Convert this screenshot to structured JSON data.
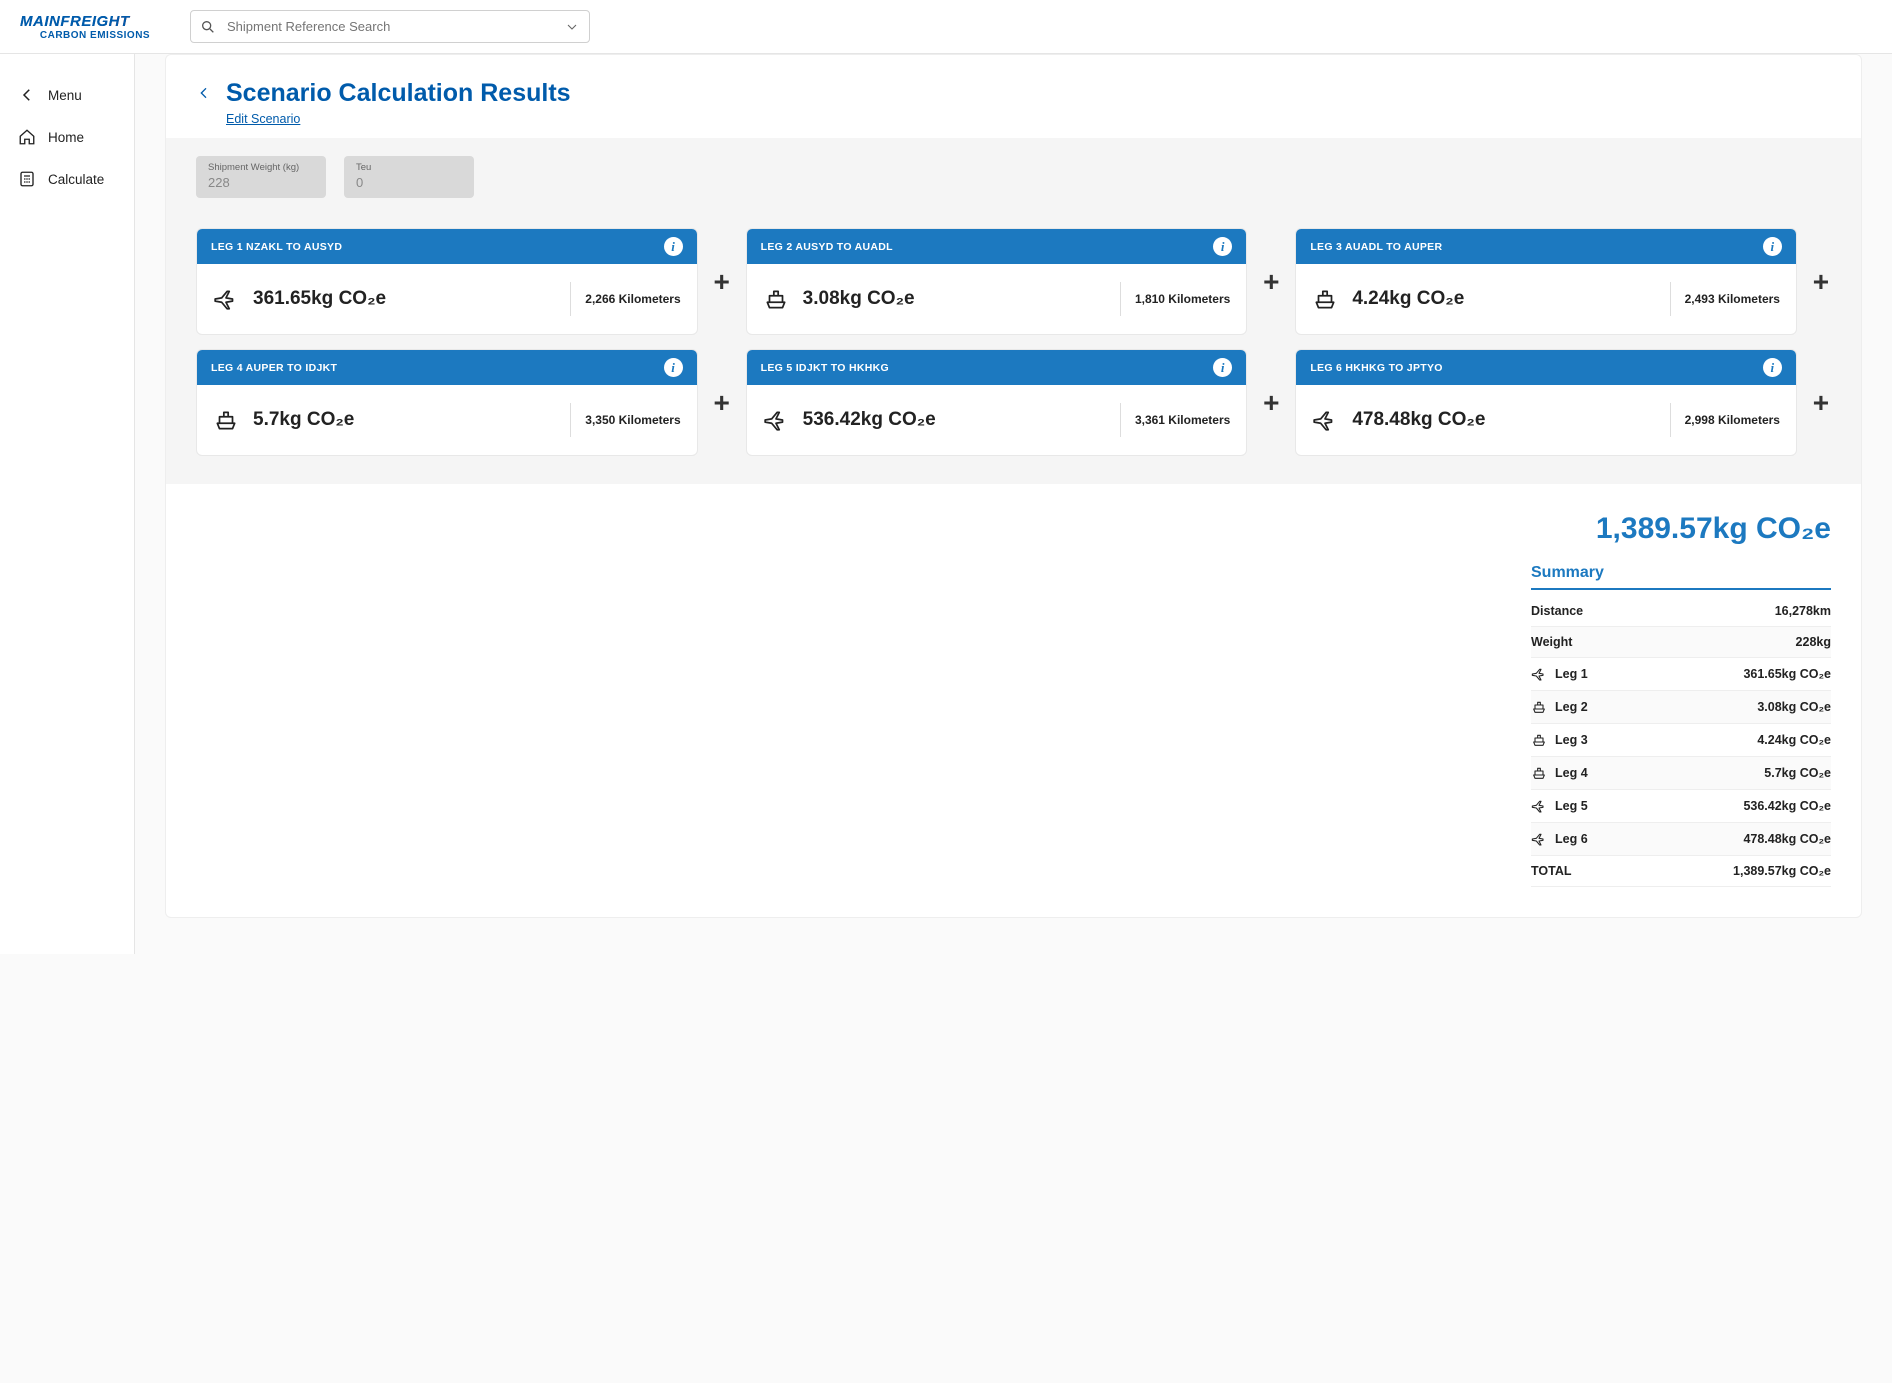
{
  "header": {
    "logo_main": "MAINFREIGHT",
    "logo_sub": "CARBON EMISSIONS",
    "search_placeholder": "Shipment Reference Search"
  },
  "sidebar": {
    "items": [
      {
        "label": "Menu",
        "icon": "chevron-left"
      },
      {
        "label": "Home",
        "icon": "home"
      },
      {
        "label": "Calculate",
        "icon": "calculate"
      }
    ]
  },
  "page": {
    "title": "Scenario Calculation Results",
    "edit_link": "Edit Scenario"
  },
  "inputs": {
    "weight_label": "Shipment Weight (kg)",
    "weight_value": "228",
    "teu_label": "Teu",
    "teu_value": "0"
  },
  "legs": [
    {
      "title": "LEG 1  NZAKL  TO  AUSYD",
      "mode": "plane",
      "co2": "361.65kg CO₂e",
      "distance": "2,266 Kilometers"
    },
    {
      "title": "LEG 2  AUSYD  TO  AUADL",
      "mode": "ship",
      "co2": "3.08kg CO₂e",
      "distance": "1,810 Kilometers"
    },
    {
      "title": "LEG 3  AUADL  TO  AUPER",
      "mode": "ship",
      "co2": "4.24kg CO₂e",
      "distance": "2,493 Kilometers"
    },
    {
      "title": "LEG 4  AUPER  TO  IDJKT",
      "mode": "ship",
      "co2": "5.7kg CO₂e",
      "distance": "3,350 Kilometers"
    },
    {
      "title": "LEG 5  IDJKT  TO  HKHKG",
      "mode": "plane",
      "co2": "536.42kg CO₂e",
      "distance": "3,361 Kilometers"
    },
    {
      "title": "LEG 6  HKHKG  TO  JPTYO",
      "mode": "plane",
      "co2": "478.48kg CO₂e",
      "distance": "2,998 Kilometers"
    }
  ],
  "total": "1,389.57kg CO₂e",
  "summary": {
    "title": "Summary",
    "rows": [
      {
        "label": "Distance",
        "value": "16,278km",
        "icon": ""
      },
      {
        "label": "Weight",
        "value": "228kg",
        "icon": ""
      },
      {
        "label": "Leg 1",
        "value": "361.65kg CO₂e",
        "icon": "plane"
      },
      {
        "label": "Leg 2",
        "value": "3.08kg CO₂e",
        "icon": "ship"
      },
      {
        "label": "Leg 3",
        "value": "4.24kg CO₂e",
        "icon": "ship"
      },
      {
        "label": "Leg 4",
        "value": "5.7kg CO₂e",
        "icon": "ship"
      },
      {
        "label": "Leg 5",
        "value": "536.42kg CO₂e",
        "icon": "plane"
      },
      {
        "label": "Leg 6",
        "value": "478.48kg CO₂e",
        "icon": "plane"
      },
      {
        "label": "TOTAL",
        "value": "1,389.57kg CO₂e",
        "icon": ""
      }
    ]
  }
}
